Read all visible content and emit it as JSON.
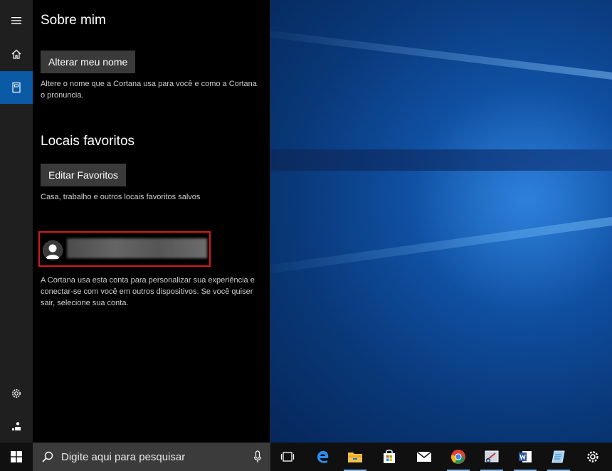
{
  "sections": {
    "about_me": {
      "title": "Sobre mim",
      "button": "Alterar meu nome",
      "description": "Altere o nome que a Cortana usa para você e como a Cortana o pronuncia."
    },
    "favorite_places": {
      "title": "Locais favoritos",
      "button": "Editar Favoritos",
      "description": "Casa, trabalho e outros locais favoritos salvos"
    },
    "account": {
      "description": "A Cortana usa esta conta para personalizar sua experiência e conectar-se com você em outros dispositivos. Se você quiser sair, selecione sua conta."
    }
  },
  "rail_icons": [
    "hamburger-icon",
    "home-icon",
    "notebook-icon",
    "settings-icon",
    "feedback-icon"
  ],
  "taskbar": {
    "search_placeholder": "Digite aqui para pesquisar",
    "apps": [
      "task-view",
      "edge",
      "file-explorer",
      "store",
      "mail",
      "chrome",
      "snipping-tool",
      "word",
      "notepad",
      "settings"
    ]
  },
  "colors": {
    "accent": "#0b5aa5",
    "highlight_border": "#d8191f",
    "taskbar_indicator": "#7fb6ef"
  }
}
